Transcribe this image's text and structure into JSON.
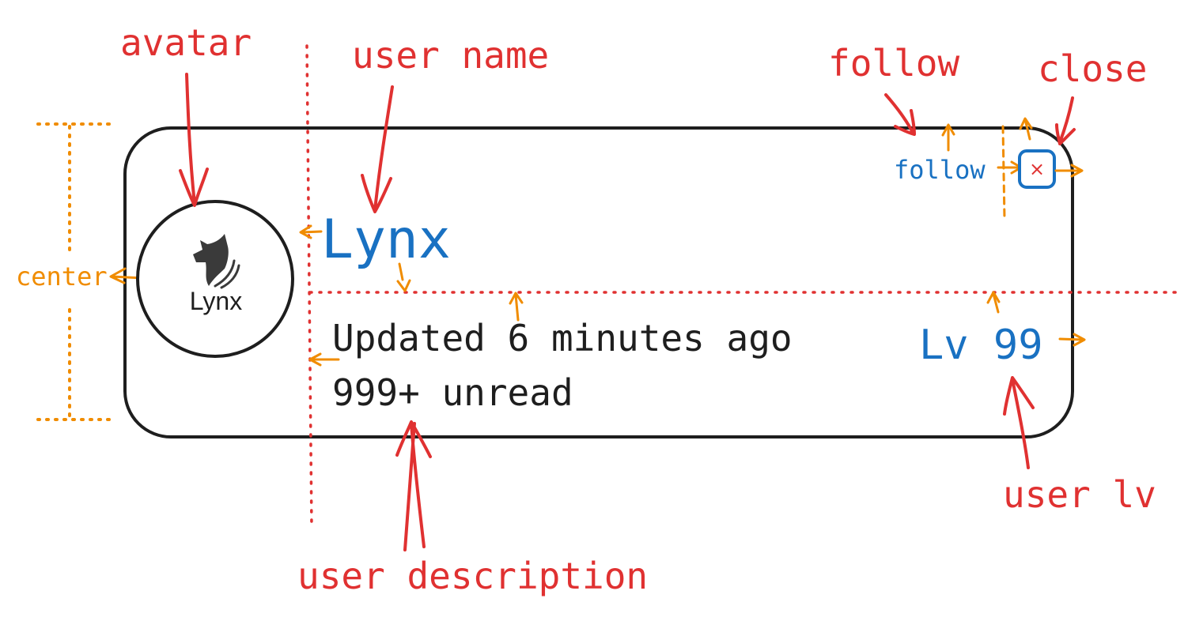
{
  "labels": {
    "avatar": "avatar",
    "user_name": "user name",
    "follow": "follow",
    "close": "close",
    "center": "center",
    "user_description": "user description",
    "user_lv": "user lv"
  },
  "card": {
    "avatar_logo_text": "Lynx",
    "user_name": "Lynx",
    "follow_label": "follow",
    "close_glyph": "×",
    "description_line_1": "Updated 6 minutes ago",
    "description_line_2": "999+ unread",
    "level": "Lv 99"
  },
  "colors": {
    "annotation_red": "#e03131",
    "guide_orange": "#f08c00",
    "accent_blue": "#1971c2",
    "ink": "#1e1e1e"
  }
}
